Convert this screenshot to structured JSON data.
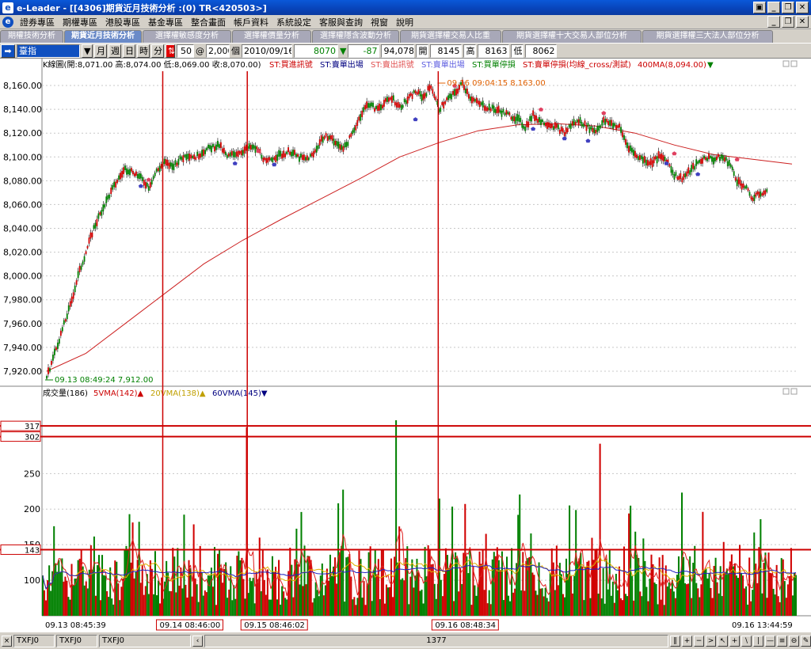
{
  "window": {
    "title": "e-Leader - [[4306]期貨近月技術分析 :(0) TR<420503>]",
    "app_icon": "e",
    "buttons": [
      "▣",
      "_",
      "❐",
      "✕"
    ]
  },
  "menu": {
    "items": [
      "證券專區",
      "期權專區",
      "港股專區",
      "基金專區",
      "整合畫面",
      "帳戶資料",
      "系統設定",
      "客服與查詢",
      "視窗",
      "說明"
    ],
    "window_buttons": [
      "_",
      "❐",
      "✕"
    ]
  },
  "tabs": [
    {
      "label": "期權技術分析",
      "active": false
    },
    {
      "label": "期貨近月技術分析",
      "active": true
    },
    {
      "label": "選擇權敏感度分析",
      "active": false
    },
    {
      "label": "選擇權價量分析",
      "active": false
    },
    {
      "label": "選擇權隱含波動分析",
      "active": false
    },
    {
      "label": "期貨選擇權交易人比重",
      "active": false
    },
    {
      "label": "期貨選擇權十大交易人部位分析",
      "active": false
    },
    {
      "label": "期貨選擇權三大法人部位分析",
      "active": false
    }
  ],
  "toolbar": {
    "symbol": "臺指",
    "periods": [
      "月",
      "週",
      "日",
      "時",
      "分"
    ],
    "count": "50",
    "at": "@",
    "count2": "2,000",
    "unit": "個",
    "date": "2010/09/16",
    "last": "8070",
    "change_arrow": "▼",
    "change": "-87",
    "volume": "94,078",
    "open_label": "開",
    "open": "8145",
    "high_label": "高",
    "high": "8163",
    "low_label": "低",
    "low": "8062"
  },
  "chart_data": {
    "type": "line",
    "info_line": "K線圖(開:8,071.00 高:8,074.00 低:8,069.00 收:8,070.00)",
    "legend": [
      {
        "label": "ST:買進訊號",
        "color": "#cc0000"
      },
      {
        "label": "ST:賣單出場",
        "color": "#000080"
      },
      {
        "label": "ST:賣出訊號",
        "color": "#e05050"
      },
      {
        "label": "ST:賣單出場",
        "color": "#6060e0"
      },
      {
        "label": "ST:買單停損",
        "color": "#008000"
      },
      {
        "label": "ST:賣單停損(均線_cross/測試)",
        "color": "#cc0000"
      },
      {
        "label": "400MA(8,094.00)",
        "color": "#cc0000"
      }
    ],
    "price_axis": {
      "ylim": [
        7910,
        8172
      ],
      "ticks": [
        "8,160.00",
        "8,140.00",
        "8,120.00",
        "8,100.00",
        "8,080.00",
        "8,060.00",
        "8,040.00",
        "8,020.00",
        "8,000.00",
        "7,980.00",
        "7,960.00",
        "7,940.00",
        "7,920.00"
      ]
    },
    "price_points": [
      [
        0,
        7915
      ],
      [
        1,
        7935
      ],
      [
        2,
        7955
      ],
      [
        3,
        7975
      ],
      [
        4,
        8000
      ],
      [
        5,
        8020
      ],
      [
        6,
        8040
      ],
      [
        7,
        8055
      ],
      [
        8,
        8068
      ],
      [
        9,
        8080
      ],
      [
        10,
        8090
      ],
      [
        11,
        8088
      ],
      [
        12,
        8082
      ],
      [
        13,
        8075
      ],
      [
        14,
        8088
      ],
      [
        15,
        8095
      ],
      [
        16,
        8092
      ],
      [
        17,
        8098
      ],
      [
        18,
        8102
      ],
      [
        19,
        8100
      ],
      [
        20,
        8105
      ],
      [
        21,
        8108
      ],
      [
        22,
        8110
      ],
      [
        23,
        8100
      ],
      [
        24,
        8103
      ],
      [
        25,
        8105
      ],
      [
        26,
        8108
      ],
      [
        27,
        8106
      ],
      [
        28,
        8095
      ],
      [
        29,
        8100
      ],
      [
        30,
        8102
      ],
      [
        31,
        8105
      ],
      [
        32,
        8100
      ],
      [
        33,
        8098
      ],
      [
        34,
        8102
      ],
      [
        35,
        8115
      ],
      [
        36,
        8118
      ],
      [
        37,
        8110
      ],
      [
        38,
        8108
      ],
      [
        39,
        8120
      ],
      [
        40,
        8135
      ],
      [
        41,
        8145
      ],
      [
        42,
        8140
      ],
      [
        43,
        8145
      ],
      [
        44,
        8150
      ],
      [
        45,
        8142
      ],
      [
        46,
        8148
      ],
      [
        47,
        8155
      ],
      [
        48,
        8150
      ],
      [
        49,
        8160
      ],
      [
        50,
        8140
      ],
      [
        51,
        8148
      ],
      [
        52,
        8153
      ],
      [
        53,
        8162
      ],
      [
        54,
        8150
      ],
      [
        55,
        8145
      ],
      [
        56,
        8142
      ],
      [
        57,
        8140
      ],
      [
        58,
        8138
      ],
      [
        59,
        8135
      ],
      [
        60,
        8132
      ],
      [
        61,
        8125
      ],
      [
        62,
        8135
      ],
      [
        63,
        8130
      ],
      [
        64,
        8128
      ],
      [
        65,
        8125
      ],
      [
        66,
        8120
      ],
      [
        67,
        8128
      ],
      [
        68,
        8130
      ],
      [
        69,
        8125
      ],
      [
        70,
        8122
      ],
      [
        71,
        8130
      ],
      [
        72,
        8128
      ],
      [
        73,
        8125
      ],
      [
        74,
        8110
      ],
      [
        75,
        8102
      ],
      [
        76,
        8098
      ],
      [
        77,
        8095
      ],
      [
        78,
        8100
      ],
      [
        79,
        8098
      ],
      [
        80,
        8085
      ],
      [
        81,
        8082
      ],
      [
        82,
        8088
      ],
      [
        83,
        8095
      ],
      [
        84,
        8100
      ],
      [
        85,
        8098
      ],
      [
        86,
        8100
      ],
      [
        87,
        8095
      ],
      [
        88,
        8080
      ],
      [
        89,
        8075
      ],
      [
        90,
        8065
      ],
      [
        91,
        8070
      ],
      [
        92,
        8070
      ]
    ],
    "ma400_points": [
      [
        0,
        7920
      ],
      [
        5,
        7935
      ],
      [
        10,
        7960
      ],
      [
        15,
        7985
      ],
      [
        20,
        8010
      ],
      [
        25,
        8030
      ],
      [
        30,
        8048
      ],
      [
        35,
        8065
      ],
      [
        40,
        8082
      ],
      [
        45,
        8100
      ],
      [
        50,
        8112
      ],
      [
        55,
        8122
      ],
      [
        60,
        8127
      ],
      [
        65,
        8128
      ],
      [
        70,
        8126
      ],
      [
        75,
        8120
      ],
      [
        80,
        8110
      ],
      [
        85,
        8102
      ],
      [
        90,
        8098
      ],
      [
        95,
        8094
      ]
    ],
    "x_count": 95,
    "markers_buy": [
      [
        12,
        8078
      ],
      [
        24,
        8097
      ],
      [
        29,
        8096
      ],
      [
        47,
        8134
      ],
      [
        62,
        8126
      ],
      [
        66,
        8118
      ],
      [
        69,
        8116
      ],
      [
        79,
        8097
      ],
      [
        83,
        8088
      ]
    ],
    "markers_sell": [
      [
        13,
        8078
      ],
      [
        27,
        8102
      ],
      [
        52,
        8157
      ],
      [
        63,
        8137
      ],
      [
        71,
        8134
      ],
      [
        80,
        8100
      ],
      [
        88,
        8095
      ]
    ],
    "annotations": [
      {
        "text": "09.16 09:04:15  8,163.00",
        "color": "#e06000"
      },
      {
        "text": "09.13 08:49:24  7,912.00",
        "color": "#008000"
      }
    ],
    "volume_info": [
      {
        "label": "成交量(186)",
        "color": "#000000"
      },
      {
        "label": "5VMA(142)▲",
        "color": "#cc0000"
      },
      {
        "label": "20VMA(138)▲",
        "color": "#c0a000"
      },
      {
        "label": "60VMA(145)▼",
        "color": "#000080"
      }
    ],
    "volume_axis": {
      "ylim": [
        50,
        355
      ],
      "ticks": [
        "250",
        "200",
        "150",
        "100"
      ],
      "marked_levels": [
        "317",
        "302",
        "143"
      ]
    },
    "x_labels": [
      "09.13 08:45:39",
      "09.14 08:46:00",
      "09.15 08:46:02",
      "09.16 08:48:34",
      "09.16 13:44:59"
    ],
    "bar_count": 470,
    "vlines": [
      0.16,
      0.272,
      0.525
    ]
  },
  "status": {
    "tabs": [
      "TXFJ0",
      "TXFJ0",
      "TXFJ0"
    ],
    "close": "×",
    "scroll_value": "1377",
    "tools": [
      "‖",
      "+",
      "−",
      ">",
      "↖",
      "+",
      "\\",
      "|",
      "—",
      "≡",
      "⊖",
      "✎"
    ]
  }
}
